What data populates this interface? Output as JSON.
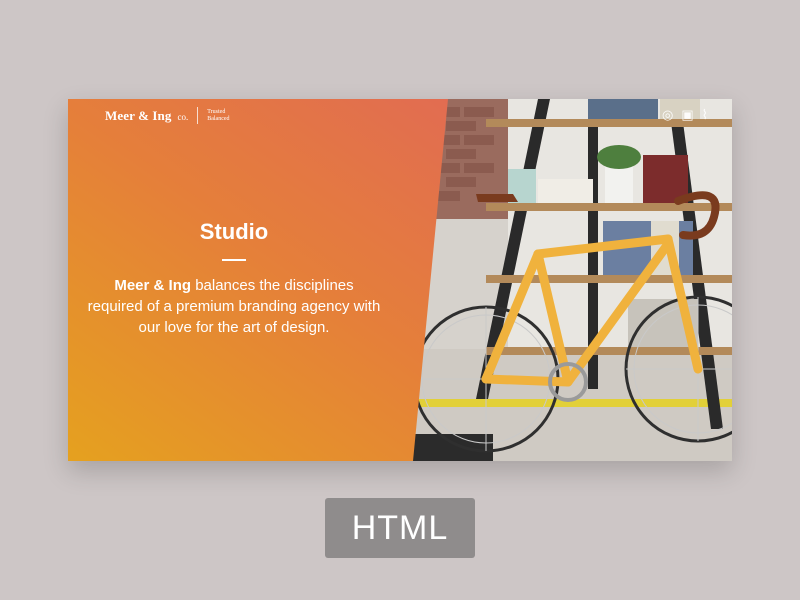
{
  "brand": {
    "name": "Meer & Ing",
    "suffix": "co.",
    "tagline_line1": "Trusted",
    "tagline_line2": "Balanced"
  },
  "hero": {
    "title": "Studio",
    "description_bold": "Meer & Ing",
    "description_rest": " balances the disciplines required of a premium branding agency with our love for the art of design."
  },
  "social_icons": [
    "dribbble-icon",
    "instagram-icon",
    "twitter-icon"
  ],
  "badge": {
    "label": "HTML"
  },
  "colors": {
    "background": "#cdc6c6",
    "gradient_start": "#e5a11f",
    "gradient_mid": "#e57f3a",
    "gradient_end": "#df5f62",
    "badge": "#8f8c8c"
  }
}
